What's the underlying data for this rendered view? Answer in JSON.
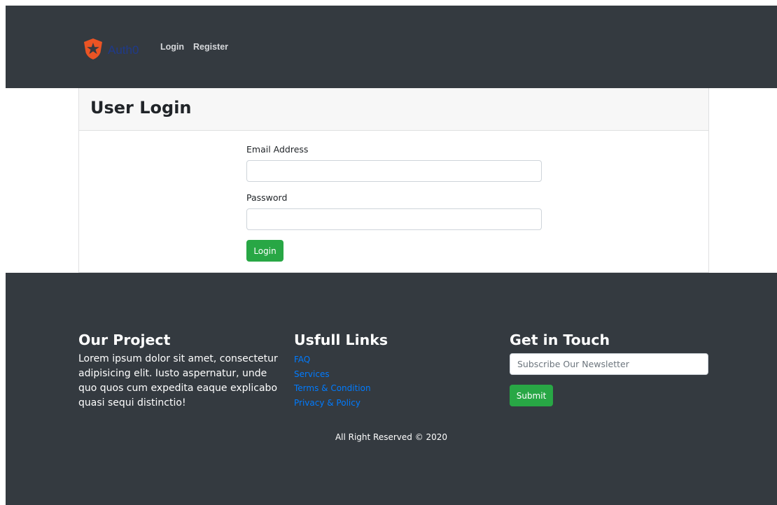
{
  "nav": {
    "brand_text": "Auth0",
    "brand_icon": "auth0-shield-icon",
    "links": [
      {
        "label": "Login"
      },
      {
        "label": "Register"
      }
    ]
  },
  "login_card": {
    "title": "User Login",
    "email_label": "Email Address",
    "email_value": "",
    "password_label": "Password",
    "password_value": "",
    "submit_label": "Login"
  },
  "footer": {
    "project": {
      "heading": "Our Project",
      "text": "Lorem ipsum dolor sit amet, consectetur adipisicing elit. Iusto aspernatur, unde quo quos cum expedita eaque explicabo quasi sequi distinctio!"
    },
    "links": {
      "heading": "Usfull Links",
      "items": [
        "FAQ",
        "Services",
        "Terms & Condition",
        "Privacy & Policy"
      ]
    },
    "touch": {
      "heading": "Get in Touch",
      "newsletter_placeholder": "Subscribe Our Newsletter",
      "submit_label": "Submit"
    },
    "copyright": "All Right Reserved © 2020"
  },
  "colors": {
    "dark": "#343a40",
    "success": "#28a745",
    "link": "#007bff",
    "brand_orange": "#eb5424"
  }
}
